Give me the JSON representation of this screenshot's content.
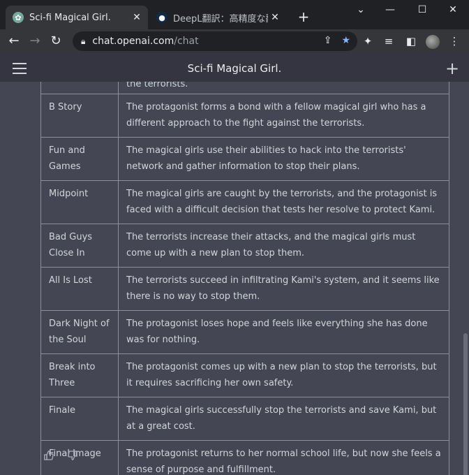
{
  "browser": {
    "tabs": [
      {
        "title": "Sci-fi Magical Girl.",
        "active": true
      },
      {
        "title": "DeepL翻訳：高精度な翻訳ツ",
        "active": false
      }
    ],
    "new_tab_glyph": "+",
    "address": {
      "host": "chat.openai.com",
      "path": "/chat"
    },
    "colors": {
      "tab_bar": "#202124",
      "toolbar": "#35363a",
      "star": "#8ab4f8"
    }
  },
  "app": {
    "title": "Sci-fi Magical Girl.",
    "new_chat_glyph": "+"
  },
  "beats": [
    {
      "label": "",
      "text": "the terrorists."
    },
    {
      "label": "B Story",
      "text": "The protagonist forms a bond with a fellow magical girl who has a different approach to the fight against the terrorists."
    },
    {
      "label": "Fun and Games",
      "text": "The magical girls use their abilities to hack into the terrorists' network and gather information to stop their plans."
    },
    {
      "label": "Midpoint",
      "text": "The magical girls are caught by the terrorists, and the protagonist is faced with a difficult decision that tests her resolve to protect Kami."
    },
    {
      "label": "Bad Guys Close In",
      "text": "The terrorists increase their attacks, and the magical girls must come up with a new plan to stop them."
    },
    {
      "label": "All Is Lost",
      "text": "The terrorists succeed in infiltrating Kami's system, and it seems like there is no way to stop them."
    },
    {
      "label": "Dark Night of the Soul",
      "text": "The protagonist loses hope and feels like everything she has done was for nothing."
    },
    {
      "label": "Break into Three",
      "text": "The protagonist comes up with a new plan to stop the terrorists, but it requires sacrificing her own safety."
    },
    {
      "label": "Finale",
      "text": "The magical girls successfully stop the terrorists and save Kami, but at a great cost."
    },
    {
      "label": "Final Image",
      "text": "The protagonist returns to her normal school life, but now she feels a sense of purpose and fulfillment."
    }
  ],
  "feedback": {
    "thumbs_up_icon": "thumbs-up-icon",
    "thumbs_down_icon": "thumbs-down-icon"
  }
}
